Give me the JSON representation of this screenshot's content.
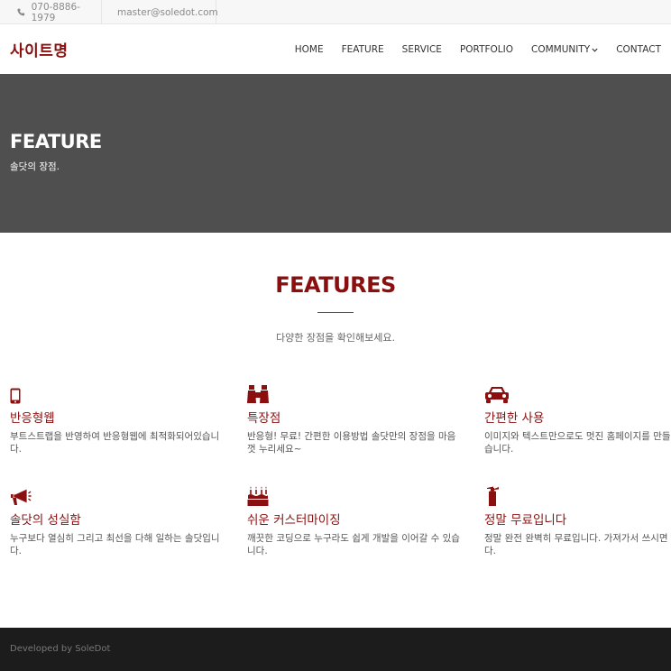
{
  "topbar": {
    "phone": "070-8886-1979",
    "email": "master@soledot.com",
    "phone_icon": "phone-icon",
    "email_icon": "envelope-icon"
  },
  "nav": {
    "logo": "사이트명",
    "items": [
      "HOME",
      "FEATURE",
      "SERVICE",
      "PORTFOLIO",
      "COMMUNITY",
      "CONTACT"
    ],
    "community_icon": "chevron-down-icon"
  },
  "hero": {
    "title": "FEATURE",
    "subtitle": "솔닷의 장점."
  },
  "section": {
    "title": "FEATURES",
    "subtitle": "다양한 장점을 확인해보세요."
  },
  "features": [
    {
      "icon": "mobile-phone-icon",
      "title": "반응형웹",
      "line1": "부트스트랩을 반영하여 반응형웹에 최적화되어있습니",
      "line2": "다."
    },
    {
      "icon": "binoculars-icon",
      "title": "특장점",
      "line1": "반응형! 무료! 간편한 이용방법 솔닷만의 장점을 마음",
      "line2": "껏 누리세요~"
    },
    {
      "icon": "car-icon",
      "title": "간편한 사용",
      "line1": "이미지와 텍스트만으로도 멋진 홈페이지를 만들",
      "line2": "습니다."
    },
    {
      "icon": "megaphone-icon",
      "title": "솔닷의 성실함",
      "line1": "누구보다 열심히 그리고 최선을 다해 일하는 솔닷입니",
      "line2": "다."
    },
    {
      "icon": "birthday-cake-icon",
      "title": "쉬운 커스터마이징",
      "line1": "깨끗한 코딩으로 누구라도 쉽게 개발을 이어갈 수 있습",
      "line2": "니다."
    },
    {
      "icon": "fire-extinguisher-icon",
      "title": "정말 무료입니다",
      "line1": "정말 완전 완벽히 무료입니다. 가져가서 쓰시면",
      "line2": "다."
    }
  ],
  "footer": {
    "text": "Developed by SoleDot"
  },
  "colors": {
    "accent": "#8b0f0f",
    "hero_bg": "#4f4f4f",
    "footer_bg": "#1c1c1c"
  }
}
